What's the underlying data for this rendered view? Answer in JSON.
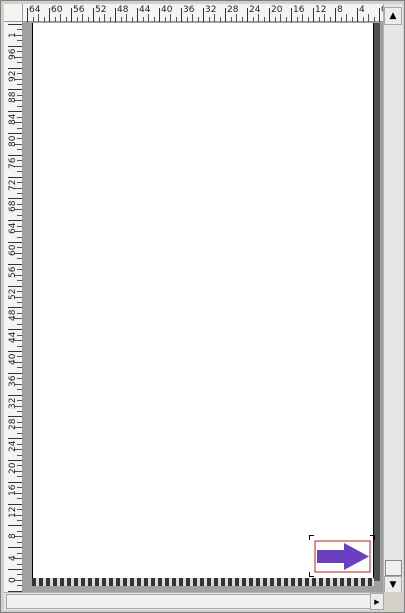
{
  "ruler_top": {
    "labels": [
      "64",
      "60",
      "56",
      "52",
      "48",
      "44",
      "40",
      "36",
      "32",
      "28",
      "24",
      "20",
      "16",
      "12",
      "8",
      "4",
      "0"
    ]
  },
  "ruler_left": {
    "labels": [
      "1",
      "96",
      "92",
      "88",
      "84",
      "80",
      "76",
      "72",
      "68",
      "64",
      "60",
      "56",
      "52",
      "48",
      "44",
      "40",
      "36",
      "32",
      "28",
      "24",
      "20",
      "16",
      "12",
      "8",
      "4",
      "0",
      "4"
    ]
  },
  "vertical_scrollbar": {
    "up_glyph": "▲",
    "down_glyph": "▼"
  },
  "horizontal_scrollbar": {
    "left_glyph": "◀",
    "right_glyph": "▶"
  },
  "shape": {
    "icon": "right-arrow-icon",
    "fill_color": "#6a3fc0",
    "border_color": "#b02020"
  },
  "colors": {
    "workspace": "#a0a0a0",
    "page": "#ffffff",
    "ruler": "#f4f4f4"
  }
}
